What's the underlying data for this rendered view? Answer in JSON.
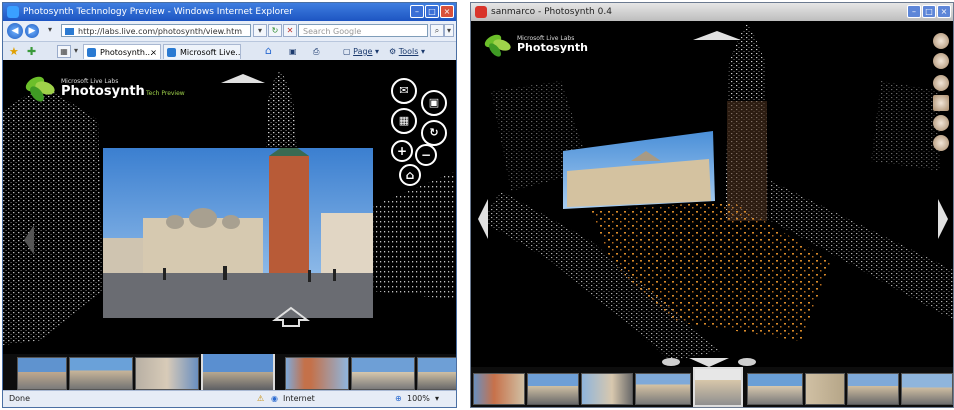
{
  "left_window": {
    "title": "Photosynth Technology Preview - Windows Internet Explorer",
    "address": "http://labs.live.com/photosynth/view.htm",
    "search_placeholder": "Search Google",
    "tabs": [
      {
        "label": "Photosynth..."
      },
      {
        "label": "Microsoft Live..."
      }
    ],
    "toolbar": {
      "page_label": "Page",
      "tools_label": "Tools"
    },
    "logo": {
      "lab": "Microsoft Live Labs",
      "name": "Photosynth",
      "sub": "Tech Preview"
    },
    "status": {
      "left": "Done",
      "zone": "Internet",
      "zoom": "100%"
    }
  },
  "right_window": {
    "title": "sanmarco - Photosynth 0.4",
    "logo": {
      "lab": "Microsoft Live Labs",
      "name": "Photosynth"
    }
  },
  "colors": {
    "ie_title": "#1d55c2",
    "accent_green": "#9fd24a",
    "pointcloud_orange": "#d98a2a",
    "sky_blue": "#4a8fd8"
  }
}
